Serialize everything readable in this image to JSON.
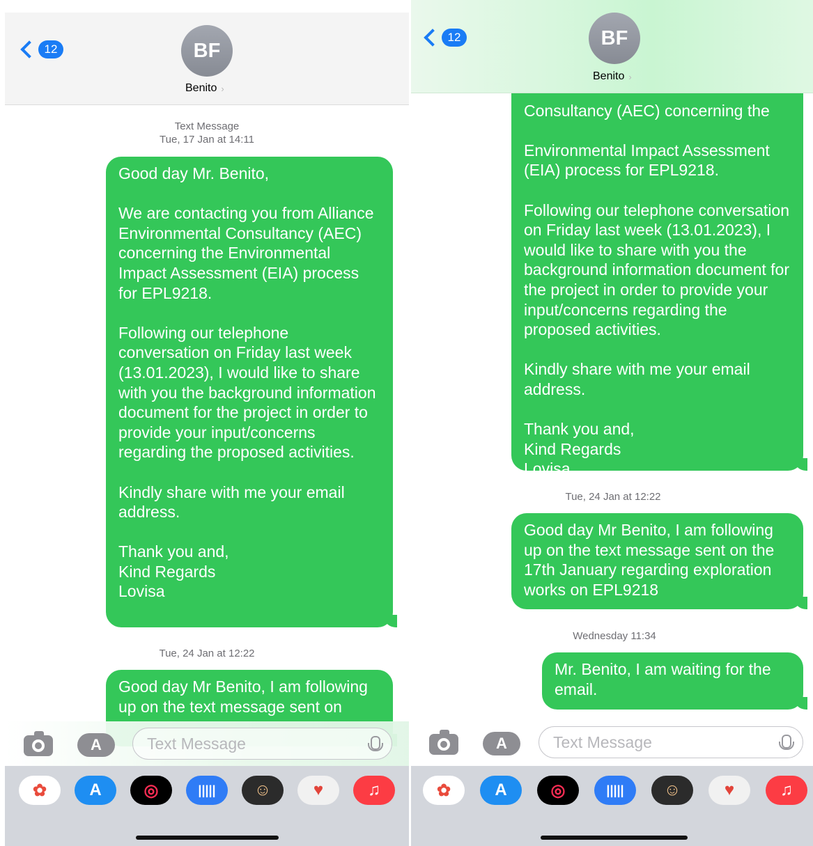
{
  "colors": {
    "bubble": "#34c759",
    "accent": "#1a7cf5",
    "avatar": "#8e9199"
  },
  "left": {
    "back_count": "12",
    "avatar_initials": "BF",
    "contact_name": "Benito",
    "header_label": "Text Message",
    "header_time": "Tue, 17 Jan at 14:11",
    "message1": "Good day Mr. Benito,\n\nWe are contacting you from Alliance Environmental Consultancy (AEC) concerning the Environmental Impact Assessment (EIA) process for EPL9218.\n\nFollowing our telephone conversation on Friday last week (13.01.2023), I would like to share with you the background information document for the project in order to provide your input/concerns regarding the proposed activities.\n\nKindly share with me your email address.\n\nThank you and,\nKind Regards\nLovisa",
    "time2": "Tue, 24 Jan at 12:22",
    "message2_partial": "Good day Mr Benito, I am following up on the text message sent on",
    "input_placeholder": "Text Message"
  },
  "right": {
    "back_count": "12",
    "avatar_initials": "BF",
    "contact_name": "Benito",
    "message1_partial_top": "Consultancy (AEC) concerning the",
    "message1_tail": "Environmental Impact Assessment (EIA) process for EPL9218.\n\nFollowing our telephone conversation on Friday last week (13.01.2023), I would like to share with you the background information document for the project in order to provide your input/concerns regarding the proposed activities.\n\nKindly share with me your email address.\n\nThank you and,\nKind Regards\nLovisa",
    "time2": "Tue, 24 Jan at 12:22",
    "message2": "Good day Mr Benito, I am following up on the text message sent on the 17th January regarding exploration works on EPL9218",
    "time3": "Wednesday 11:34",
    "message3": "Mr. Benito, I am waiting for the email.",
    "input_placeholder": "Text Message"
  },
  "dock_icons": [
    "photos-icon",
    "app-store-icon",
    "activity-icon",
    "voice-memo-icon",
    "memoji-icon",
    "animoji-icon",
    "music-icon"
  ]
}
